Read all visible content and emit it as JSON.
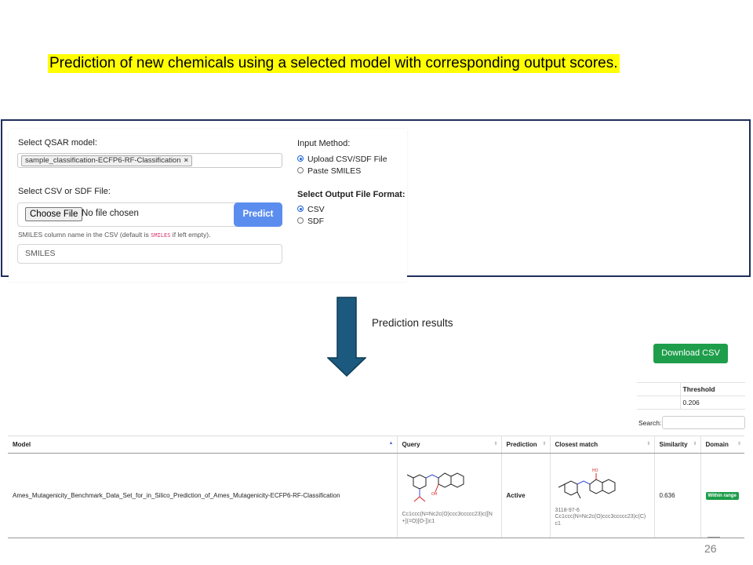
{
  "slide": {
    "title": "Prediction of new chemicals using a selected model with corresponding output scores.",
    "arrow_label": "Prediction results",
    "page_number": "26"
  },
  "form": {
    "model_label": "Select QSAR model:",
    "model_chip": "sample_classification-ECFP6-RF-Classification",
    "model_chip_remove": "×",
    "file_label": "Select CSV or SDF File:",
    "choose_file": "Choose File",
    "no_file": "No file chosen",
    "predict": "Predict",
    "hint_before": "SMILES column name in the CSV (default is ",
    "hint_code": "SMILES",
    "hint_after": " if left empty).",
    "smiles_placeholder": "SMILES",
    "input_method_label": "Input Method:",
    "input_methods": [
      {
        "label": "Upload CSV/SDF File",
        "selected": true
      },
      {
        "label": "Paste SMILES",
        "selected": false
      }
    ],
    "output_format_label": "Select Output File Format:",
    "output_formats": [
      {
        "label": "CSV",
        "selected": true
      },
      {
        "label": "SDF",
        "selected": false
      }
    ]
  },
  "results": {
    "download": "Download CSV",
    "threshold_header": "Threshold",
    "threshold_value": "0.206",
    "search_label": "Search:",
    "columns": [
      "Model",
      "Query",
      "Prediction",
      "Closest match",
      "Similarity",
      "Domain"
    ],
    "row": {
      "model": "Ames_Mutagenicity_Benchmark_Data_Set_for_in_Silico_Prediction_of_Ames_Mutagenicity-ECFP6-RF-Classification",
      "query_smiles": "Cc1ccc(N=Nc2c(O)ccc3ccccc23)c([N+](=O)[O-])c1",
      "prediction": "Active",
      "match_cas": "3118-97-6",
      "match_smiles": "Cc1ccc(N=Nc2c(O)ccc3ccccc23)c(C)c1",
      "similarity": "0.636",
      "domain": "Within range"
    }
  },
  "colors": {
    "highlight": "#ffff00",
    "frame": "#1f2d5a",
    "predict_button": "#5b8def",
    "download_button": "#1e9e4a",
    "arrow": "#1b5a7e",
    "domain_badge": "#1e9e4a"
  },
  "icons": [
    "arrow-down-icon",
    "sort-icon",
    "molecule-structure"
  ]
}
